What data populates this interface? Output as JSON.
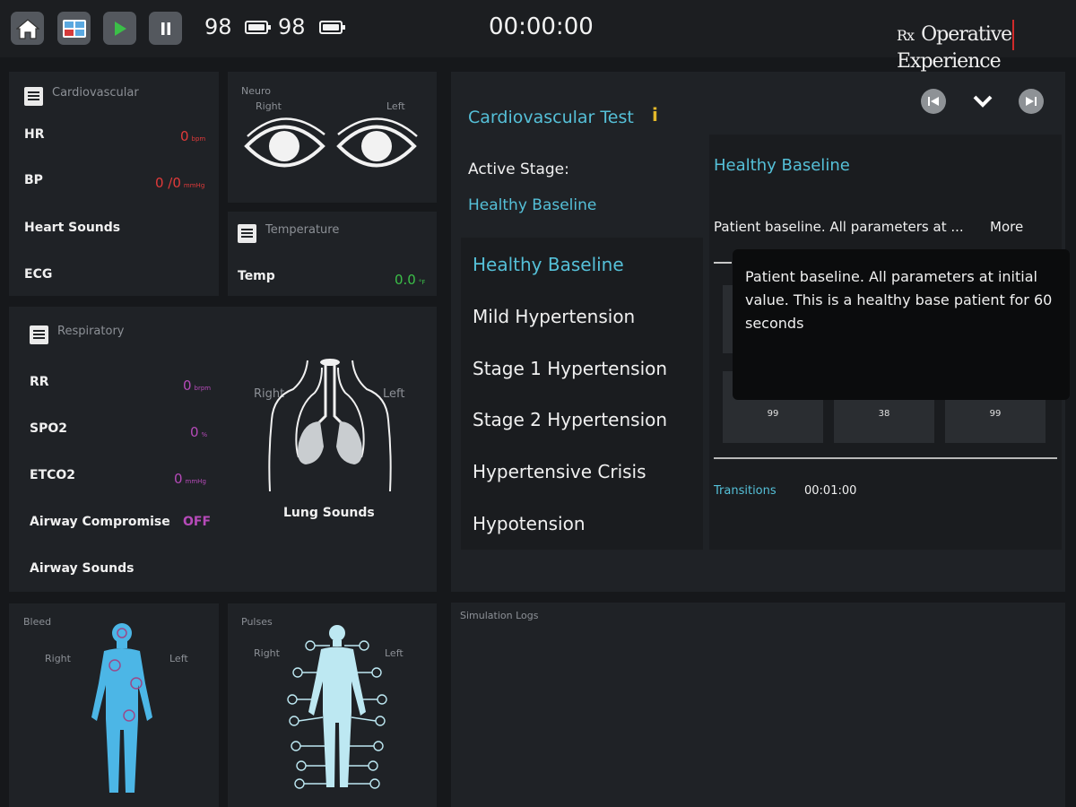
{
  "topbar": {
    "value_1": "98",
    "value_2": "98",
    "timer": "00:00:00",
    "brand_rx": "Rx",
    "brand_word1": "Operative",
    "brand_word2": "Experience"
  },
  "cardio": {
    "title": "Cardiovascular",
    "hr_label": "HR",
    "hr_value": "0",
    "hr_unit": "bpm",
    "bp_label": "BP",
    "bp_value": "0 /0",
    "bp_unit": "mmHg",
    "sounds_label": "Heart Sounds",
    "ecg_label": "ECG"
  },
  "neuro": {
    "title": "Neuro",
    "right": "Right",
    "left": "Left"
  },
  "temperature": {
    "title": "Temperature",
    "label": "Temp",
    "value": "0.0",
    "unit": "°F"
  },
  "resp": {
    "title": "Respiratory",
    "rr_label": "RR",
    "rr_value": "0",
    "rr_unit": "brpm",
    "spo2_label": "SPO2",
    "spo2_value": "0",
    "spo2_unit": "%",
    "etco2_label": "ETCO2",
    "etco2_value": "0",
    "etco2_unit": "mmHg",
    "airway_label": "Airway Compromise",
    "airway_value": "OFF",
    "airway_sounds_label": "Airway Sounds",
    "right": "Right",
    "left": "Left",
    "lung_sounds": "Lung Sounds"
  },
  "bleed": {
    "title": "Bleed",
    "right": "Right",
    "left": "Left"
  },
  "pulses": {
    "title": "Pulses",
    "right": "Right",
    "left": "Left"
  },
  "test": {
    "title": "Cardiovascular Test",
    "info_glyph": "i",
    "active_stage_label": "Active Stage:",
    "active_stage_value": "Healthy Baseline",
    "stages": [
      "Healthy Baseline",
      "Mild Hypertension",
      "Stage 1 Hypertension",
      "Stage 2 Hypertension",
      "Hypertensive Crisis",
      "Hypotension"
    ],
    "detail_title": "Healthy Baseline",
    "detail_desc": "Patient baseline. All parameters at ...",
    "more": "More",
    "tooltip": "Patient baseline. All parameters at initial value. This is a healthy base patient for 60 seconds",
    "cells": [
      "99",
      "38",
      "99"
    ],
    "transitions_label": "Transitions",
    "transitions_value": "00:01:00"
  },
  "logs": {
    "title": "Simulation Logs"
  },
  "colors": {
    "accent": "#55c0d8",
    "alarm_red": "#e03a3a",
    "temp_green": "#3bbf48",
    "resp_purple": "#b54ab8",
    "info_yellow": "#e3b82a"
  }
}
